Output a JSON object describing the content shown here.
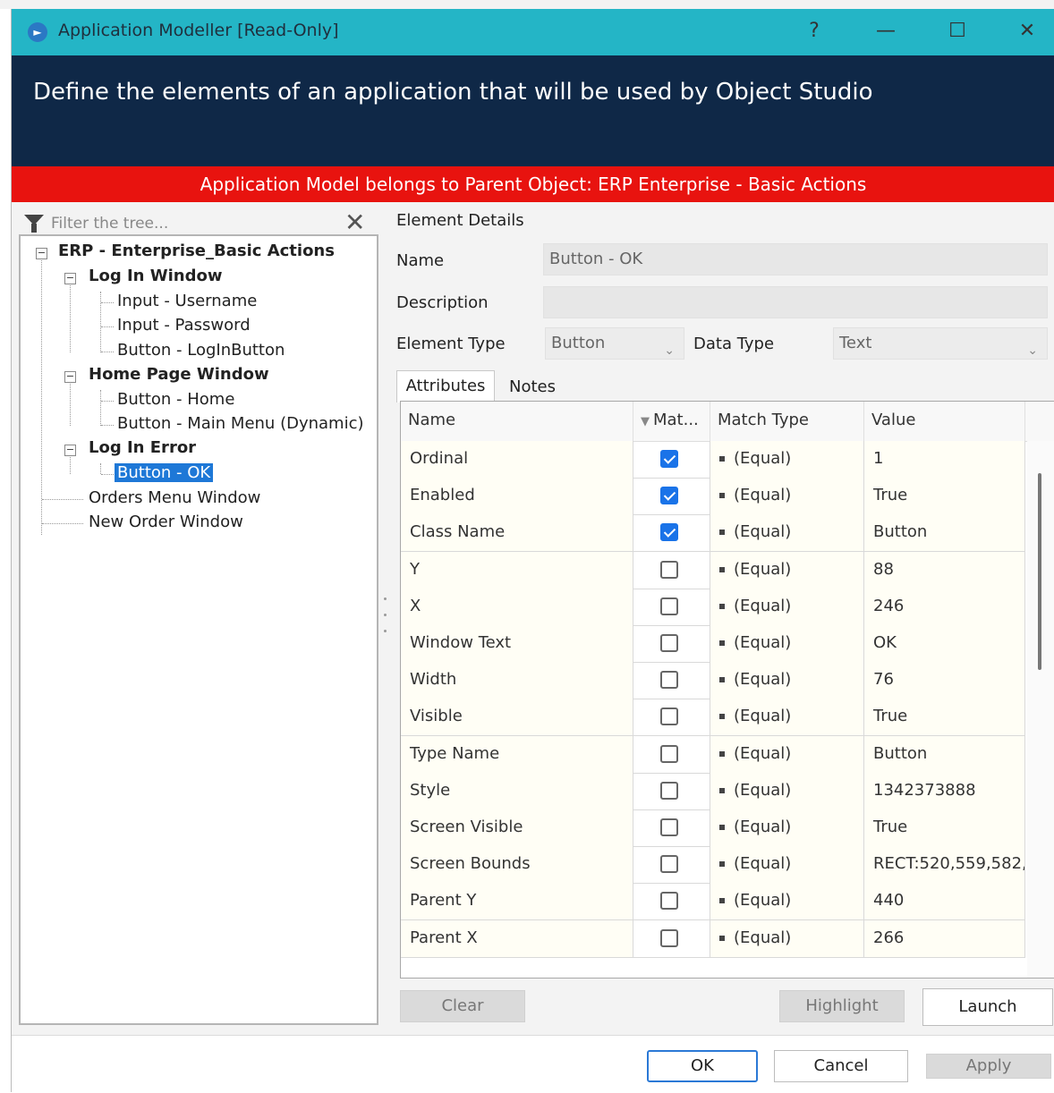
{
  "window": {
    "title": "Application Modeller [Read-Only]",
    "help": "?",
    "minimize": "—",
    "maximize": "☐",
    "close": "✕"
  },
  "header": {
    "text": "Define the elements of an application that will be used by Object Studio"
  },
  "banner": {
    "text": "Application Model belongs to Parent Object: ERP Enterprise - Basic Actions",
    "color": "#e8130f"
  },
  "filter": {
    "placeholder": "Filter the tree..."
  },
  "tree": {
    "root": "ERP - Enterprise_Basic Actions",
    "login_window": "Log In Window",
    "input_username": "Input - Username",
    "input_password": "Input - Password",
    "button_login": "Button - LogInButton",
    "home_window": "Home Page Window",
    "button_home": "Button - Home",
    "button_main_menu": "Button - Main Menu (Dynamic)",
    "login_error": "Log In Error",
    "button_ok": "Button - OK",
    "orders_menu": "Orders Menu Window",
    "new_order": "New Order Window"
  },
  "details": {
    "heading": "Element Details",
    "name_label": "Name",
    "name_value": "Button - OK",
    "description_label": "Description",
    "description_value": "",
    "element_type_label": "Element Type",
    "element_type_value": "Button",
    "data_type_label": "Data Type",
    "data_type_value": "Text"
  },
  "tabs": {
    "attributes": "Attributes",
    "notes": "Notes"
  },
  "grid": {
    "headers": {
      "name": "Name",
      "match": "Mat...",
      "match_type": "Match Type",
      "value": "Value"
    },
    "rows": [
      {
        "name": "Ordinal",
        "checked": true,
        "match_type": "= (Equal)",
        "value": "1"
      },
      {
        "name": "Enabled",
        "checked": true,
        "match_type": "= (Equal)",
        "value": "True"
      },
      {
        "name": "Class Name",
        "checked": true,
        "match_type": "= (Equal)",
        "value": "Button"
      },
      {
        "name": "Y",
        "checked": false,
        "match_type": "= (Equal)",
        "value": "88"
      },
      {
        "name": "X",
        "checked": false,
        "match_type": "= (Equal)",
        "value": "246"
      },
      {
        "name": "Window Text",
        "checked": false,
        "match_type": "= (Equal)",
        "value": "OK"
      },
      {
        "name": "Width",
        "checked": false,
        "match_type": "= (Equal)",
        "value": "76"
      },
      {
        "name": "Visible",
        "checked": false,
        "match_type": "= (Equal)",
        "value": "True"
      },
      {
        "name": "Type Name",
        "checked": false,
        "match_type": "= (Equal)",
        "value": "Button"
      },
      {
        "name": "Style",
        "checked": false,
        "match_type": "= (Equal)",
        "value": "1342373888"
      },
      {
        "name": "Screen Visible",
        "checked": false,
        "match_type": "= (Equal)",
        "value": "True"
      },
      {
        "name": "Screen Bounds",
        "checked": false,
        "match_type": "= (Equal)",
        "value": "RECT:520,559,582,..."
      },
      {
        "name": "Parent Y",
        "checked": false,
        "match_type": "= (Equal)",
        "value": "440"
      },
      {
        "name": "Parent X",
        "checked": false,
        "match_type": "= (Equal)",
        "value": "266"
      }
    ]
  },
  "buttons": {
    "clear": "Clear",
    "highlight": "Highlight",
    "launch": "Launch",
    "ok": "OK",
    "cancel": "Cancel",
    "apply": "Apply"
  }
}
